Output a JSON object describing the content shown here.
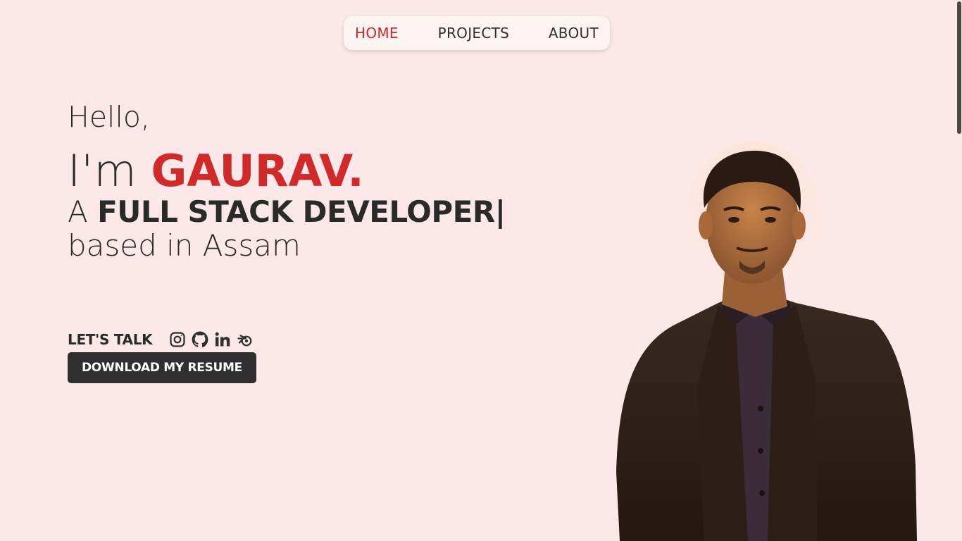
{
  "nav": {
    "items": [
      {
        "label": "HOME",
        "active": true
      },
      {
        "label": "PROJECTS",
        "active": false
      },
      {
        "label": "ABOUT",
        "active": false
      }
    ]
  },
  "hero": {
    "greeting": "Hello,",
    "im": "I'm",
    "name": "GAURAV.",
    "role_prefix": "A",
    "role_title": "FULL STACK DEVELOPER",
    "cursor": "|",
    "location": "based in Assam"
  },
  "contact": {
    "label": "LET'S TALK",
    "icons": [
      "instagram-icon",
      "github-icon",
      "linkedin-icon",
      "blender-icon"
    ],
    "resume_button": "DOWNLOAD MY RESUME"
  },
  "colors": {
    "background": "#fce8e8",
    "accent": "#d02a2a",
    "text": "#2f2f2f"
  }
}
